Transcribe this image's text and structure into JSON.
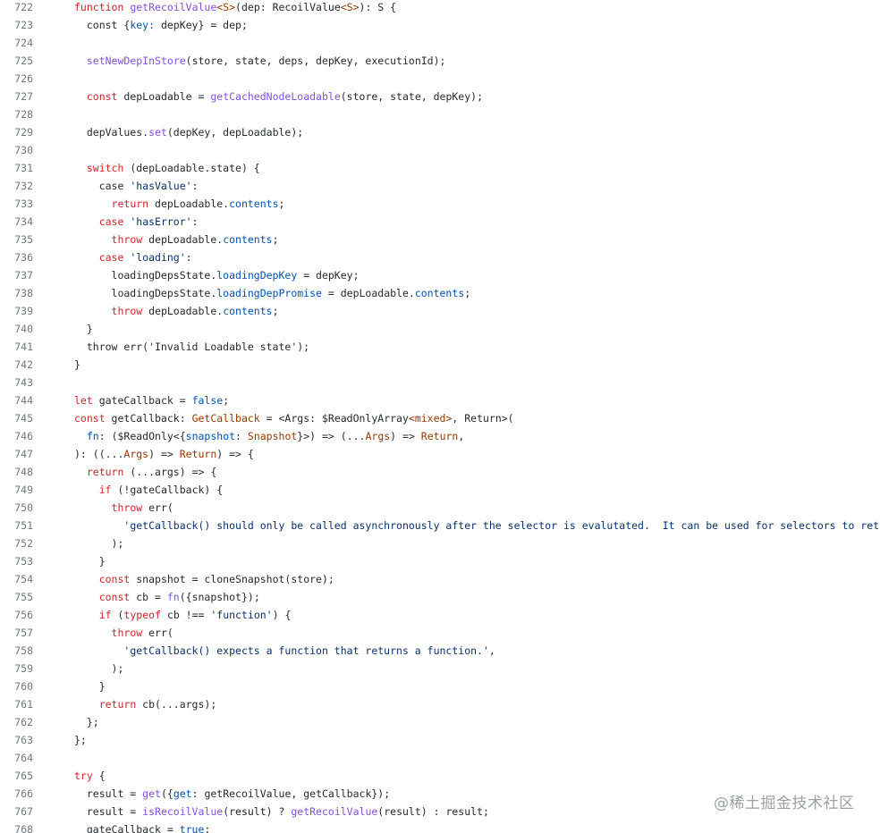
{
  "code": {
    "lines": [
      {
        "num": "722",
        "parts": [
          {
            "t": "function",
            "c": "k"
          },
          {
            "t": " "
          },
          {
            "t": "getRecoilValue",
            "c": "f"
          },
          {
            "t": "<S>",
            "c": "t"
          },
          {
            "t": "(dep: RecoilValue"
          },
          {
            "t": "<S>",
            "c": "t"
          },
          {
            "t": "): S {"
          }
        ]
      },
      {
        "num": "723",
        "parts": [
          {
            "t": "  const {"
          },
          {
            "t": "key:",
            "c": "p"
          },
          {
            "t": " depKey} = dep;"
          }
        ]
      },
      {
        "num": "724",
        "parts": []
      },
      {
        "num": "725",
        "parts": [
          {
            "t": "  "
          },
          {
            "t": "setNewDepInStore",
            "c": "f"
          },
          {
            "t": "(store, state, deps, depKey, executionId);"
          }
        ]
      },
      {
        "num": "726",
        "parts": []
      },
      {
        "num": "727",
        "parts": [
          {
            "t": "  "
          },
          {
            "t": "const",
            "c": "k"
          },
          {
            "t": " depLoadable = "
          },
          {
            "t": "getCachedNodeLoadable",
            "c": "f"
          },
          {
            "t": "(store, state, depKey);"
          }
        ]
      },
      {
        "num": "728",
        "parts": []
      },
      {
        "num": "729",
        "parts": [
          {
            "t": "  depValues."
          },
          {
            "t": "set",
            "c": "f"
          },
          {
            "t": "(depKey, depLoadable);"
          }
        ]
      },
      {
        "num": "730",
        "parts": []
      },
      {
        "num": "731",
        "parts": [
          {
            "t": "  "
          },
          {
            "t": "switch",
            "c": "k"
          },
          {
            "t": " (depLoadable.state) {"
          }
        ]
      },
      {
        "num": "732",
        "parts": [
          {
            "t": "    case "
          },
          {
            "t": "'hasValue'",
            "c": "s"
          },
          {
            "t": ":"
          }
        ]
      },
      {
        "num": "733",
        "parts": [
          {
            "t": "      "
          },
          {
            "t": "return",
            "c": "k"
          },
          {
            "t": " depLoadable."
          },
          {
            "t": "contents",
            "c": "p"
          },
          {
            "t": ";"
          }
        ]
      },
      {
        "num": "734",
        "parts": [
          {
            "t": "    "
          },
          {
            "t": "case",
            "c": "k"
          },
          {
            "t": " "
          },
          {
            "t": "'hasError'",
            "c": "s"
          },
          {
            "t": ":"
          }
        ]
      },
      {
        "num": "735",
        "parts": [
          {
            "t": "      "
          },
          {
            "t": "throw",
            "c": "k"
          },
          {
            "t": " depLoadable."
          },
          {
            "t": "contents",
            "c": "p"
          },
          {
            "t": ";"
          }
        ]
      },
      {
        "num": "736",
        "parts": [
          {
            "t": "    "
          },
          {
            "t": "case",
            "c": "k"
          },
          {
            "t": " "
          },
          {
            "t": "'loading'",
            "c": "s"
          },
          {
            "t": ":"
          }
        ]
      },
      {
        "num": "737",
        "parts": [
          {
            "t": "      loadingDepsState."
          },
          {
            "t": "loadingDepKey",
            "c": "p"
          },
          {
            "t": " = depKey;"
          }
        ]
      },
      {
        "num": "738",
        "parts": [
          {
            "t": "      loadingDepsState."
          },
          {
            "t": "loadingDepPromise",
            "c": "p"
          },
          {
            "t": " = depLoadable."
          },
          {
            "t": "contents",
            "c": "p"
          },
          {
            "t": ";"
          }
        ]
      },
      {
        "num": "739",
        "parts": [
          {
            "t": "      "
          },
          {
            "t": "throw",
            "c": "k"
          },
          {
            "t": " depLoadable."
          },
          {
            "t": "contents",
            "c": "p"
          },
          {
            "t": ";"
          }
        ]
      },
      {
        "num": "740",
        "parts": [
          {
            "t": "  }"
          }
        ]
      },
      {
        "num": "741",
        "parts": [
          {
            "t": "  throw err('Invalid Loadable state');"
          }
        ]
      },
      {
        "num": "742",
        "parts": [
          {
            "t": "}"
          }
        ]
      },
      {
        "num": "743",
        "parts": []
      },
      {
        "num": "744",
        "parts": [
          {
            "t": "let",
            "c": "k"
          },
          {
            "t": " gateCallback = "
          },
          {
            "t": "false",
            "c": "p"
          },
          {
            "t": ";"
          }
        ]
      },
      {
        "num": "745",
        "parts": [
          {
            "t": "const",
            "c": "k"
          },
          {
            "t": " getCallback: "
          },
          {
            "t": "GetCallback",
            "c": "t"
          },
          {
            "t": " = <Args: $ReadOnlyArray"
          },
          {
            "t": "<mixed>",
            "c": "t"
          },
          {
            "t": ", Return>("
          }
        ]
      },
      {
        "num": "746",
        "parts": [
          {
            "t": "  "
          },
          {
            "t": "fn",
            "c": "p"
          },
          {
            "t": ": ($ReadOnly<{"
          },
          {
            "t": "snapshot",
            "c": "p"
          },
          {
            "t": ": "
          },
          {
            "t": "Snapshot",
            "c": "t"
          },
          {
            "t": "}>) => (..."
          },
          {
            "t": "Args",
            "c": "t"
          },
          {
            "t": ") => "
          },
          {
            "t": "Return",
            "c": "t"
          },
          {
            "t": ","
          }
        ]
      },
      {
        "num": "747",
        "parts": [
          {
            "t": "): ((..."
          },
          {
            "t": "Args",
            "c": "t"
          },
          {
            "t": ") => "
          },
          {
            "t": "Return",
            "c": "t"
          },
          {
            "t": ") => {"
          }
        ]
      },
      {
        "num": "748",
        "parts": [
          {
            "t": "  "
          },
          {
            "t": "return",
            "c": "k"
          },
          {
            "t": " (...args) => {"
          }
        ]
      },
      {
        "num": "749",
        "parts": [
          {
            "t": "    "
          },
          {
            "t": "if",
            "c": "k"
          },
          {
            "t": " (!gateCallback) {"
          }
        ]
      },
      {
        "num": "750",
        "parts": [
          {
            "t": "      "
          },
          {
            "t": "throw",
            "c": "k"
          },
          {
            "t": " err("
          }
        ]
      },
      {
        "num": "751",
        "parts": [
          {
            "t": "        "
          },
          {
            "t": "'getCallback() should only be called asynchronously after the selector is evalutated.  It can be used for selectors to return obj",
            "c": "s"
          }
        ]
      },
      {
        "num": "752",
        "parts": [
          {
            "t": "      );"
          }
        ]
      },
      {
        "num": "753",
        "parts": [
          {
            "t": "    }"
          }
        ]
      },
      {
        "num": "754",
        "parts": [
          {
            "t": "    "
          },
          {
            "t": "const",
            "c": "k"
          },
          {
            "t": " snapshot = cloneSnapshot(store);"
          }
        ]
      },
      {
        "num": "755",
        "parts": [
          {
            "t": "    "
          },
          {
            "t": "const",
            "c": "k"
          },
          {
            "t": " cb = "
          },
          {
            "t": "fn",
            "c": "f"
          },
          {
            "t": "({snapshot});"
          }
        ]
      },
      {
        "num": "756",
        "parts": [
          {
            "t": "    "
          },
          {
            "t": "if",
            "c": "k"
          },
          {
            "t": " ("
          },
          {
            "t": "typeof",
            "c": "k"
          },
          {
            "t": " cb !== "
          },
          {
            "t": "'function'",
            "c": "s"
          },
          {
            "t": ") {"
          }
        ]
      },
      {
        "num": "757",
        "parts": [
          {
            "t": "      "
          },
          {
            "t": "throw",
            "c": "k"
          },
          {
            "t": " err("
          }
        ]
      },
      {
        "num": "758",
        "parts": [
          {
            "t": "        "
          },
          {
            "t": "'getCallback() expects a function that returns a function.'",
            "c": "s"
          },
          {
            "t": ","
          }
        ]
      },
      {
        "num": "759",
        "parts": [
          {
            "t": "      );"
          }
        ]
      },
      {
        "num": "760",
        "parts": [
          {
            "t": "    }"
          }
        ]
      },
      {
        "num": "761",
        "parts": [
          {
            "t": "    "
          },
          {
            "t": "return",
            "c": "k"
          },
          {
            "t": " cb(...args);"
          }
        ]
      },
      {
        "num": "762",
        "parts": [
          {
            "t": "  };"
          }
        ]
      },
      {
        "num": "763",
        "parts": [
          {
            "t": "};"
          }
        ]
      },
      {
        "num": "764",
        "parts": []
      },
      {
        "num": "765",
        "parts": [
          {
            "t": "try",
            "c": "k"
          },
          {
            "t": " {"
          }
        ]
      },
      {
        "num": "766",
        "parts": [
          {
            "t": "  result = "
          },
          {
            "t": "get",
            "c": "f"
          },
          {
            "t": "({"
          },
          {
            "t": "get",
            "c": "p"
          },
          {
            "t": ": getRecoilValue, getCallback});"
          }
        ]
      },
      {
        "num": "767",
        "parts": [
          {
            "t": "  result = "
          },
          {
            "t": "isRecoilValue",
            "c": "f"
          },
          {
            "t": "(result) ? "
          },
          {
            "t": "getRecoilValue",
            "c": "f"
          },
          {
            "t": "(result) : result;"
          }
        ]
      },
      {
        "num": "768",
        "parts": [
          {
            "t": "  gateCallback = "
          },
          {
            "t": "true",
            "c": "p"
          },
          {
            "t": ";"
          }
        ]
      }
    ]
  },
  "watermark": {
    "text": "@稀土掘金技术社区"
  },
  "colors": {
    "keyword": "#cf222e",
    "function": "#8250df",
    "string": "#0a3069",
    "property": "#0550ae",
    "type": "#953800",
    "default": "#24292f",
    "line_number": "#6e7781",
    "watermark": "#9aa0a6"
  }
}
